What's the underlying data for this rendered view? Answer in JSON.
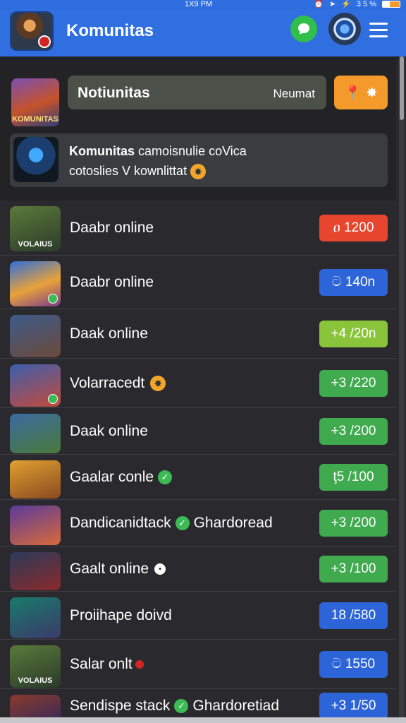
{
  "status_bar": {
    "time": "1X9 PM",
    "battery": "3 5 %"
  },
  "header": {
    "title": "Komunitas"
  },
  "search": {
    "label": "Notiunitas",
    "right_text": "Neumat"
  },
  "info_card": {
    "bold": "Komunitas",
    "line1_rest": "camoisnulie coVica",
    "line2": "cotoslies V kownlittat"
  },
  "thumb_captions": {
    "top": "KOMUNITAS",
    "volaius": "VOLAIUS"
  },
  "rows": [
    {
      "name": "Daabr online",
      "extra": "",
      "badge": "",
      "pill": "ዐ 1200",
      "color": "#e8452f"
    },
    {
      "name": "Daabr online",
      "extra": "",
      "badge": "",
      "pill": "ට 140n",
      "color": "#2d64d8"
    },
    {
      "name": "Daak online",
      "extra": "",
      "badge": "",
      "pill": "+4 /20n",
      "color": "#8ac43a"
    },
    {
      "name": "Volarracedt",
      "extra": "",
      "badge": "emoji",
      "pill": "+3 /220",
      "color": "#3faa4e"
    },
    {
      "name": "Daak online",
      "extra": "",
      "badge": "",
      "pill": "+3 /200",
      "color": "#3faa4e"
    },
    {
      "name": "Gaalar conle",
      "extra": "",
      "badge": "check",
      "pill": "ţ5 /100",
      "color": "#3faa4e"
    },
    {
      "name": "Dandicanidtack",
      "extra": "Ghardoread",
      "badge": "check",
      "pill": "+3 /200",
      "color": "#3faa4e"
    },
    {
      "name": "Gaalt online",
      "extra": "",
      "badge": "white",
      "pill": "+3 /100",
      "color": "#3faa4e"
    },
    {
      "name": "Proiihape doivd",
      "extra": "",
      "badge": "",
      "pill": "18 /580",
      "color": "#2d64d8"
    },
    {
      "name": "Salar onlt",
      "extra": "",
      "badge": "red",
      "pill": "ට 1550",
      "color": "#2d64d8"
    },
    {
      "name": "Sendispe stack",
      "extra": "Ghardoretiad",
      "badge": "check",
      "pill": "+3 1/50",
      "color": "#2d64d8"
    }
  ],
  "colors": {
    "primary": "#2f6fe0",
    "accent_orange": "#f39a2a",
    "background": "#2a2a2e"
  },
  "icons": [
    "avatar",
    "chat-icon",
    "globe-icon",
    "menu-icon",
    "pin-icon",
    "star-icon",
    "check-icon"
  ]
}
